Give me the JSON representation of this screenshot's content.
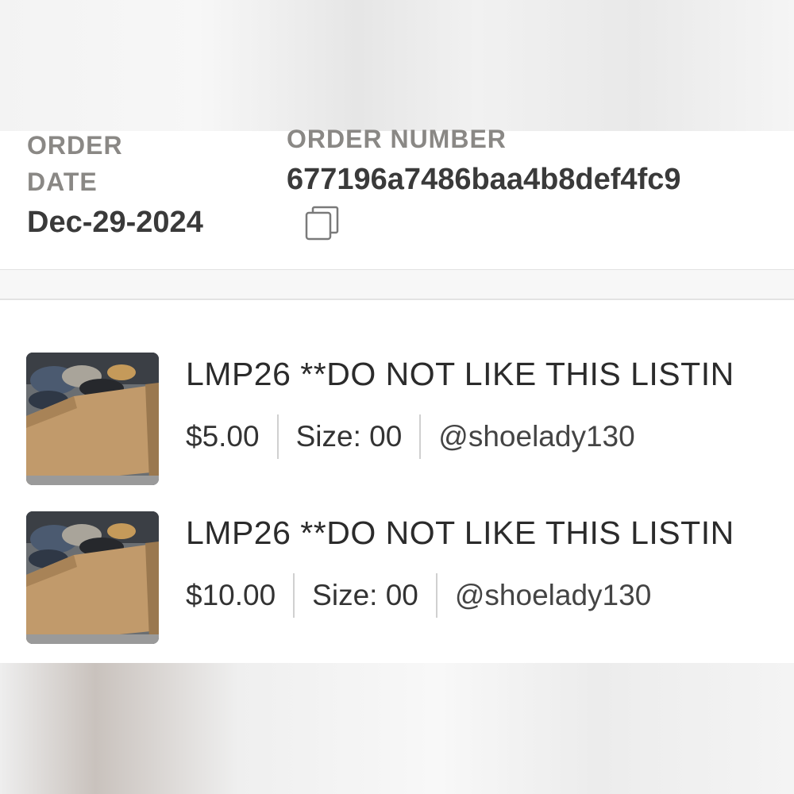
{
  "order": {
    "date_label_line1": "ORDER",
    "date_label_line2": "DATE",
    "date_value": "Dec-29-2024",
    "number_label": "ORDER NUMBER",
    "number_value": "677196a7486baa4b8def4fc9",
    "copy_icon": "copy-icon"
  },
  "items": [
    {
      "title": "LMP26 **DO NOT LIKE THIS LISTIN",
      "price": "$5.00",
      "size": "Size: 00",
      "seller": "@shoelady130",
      "image": "cardboard box of clothes"
    },
    {
      "title": "LMP26 **DO NOT LIKE THIS LISTIN",
      "price": "$10.00",
      "size": "Size: 00",
      "seller": "@shoelady130",
      "image": "cardboard box of clothes"
    }
  ],
  "colors": {
    "label": "#8a8885",
    "text": "#3a3a3a",
    "divider": "#e3e3e3"
  }
}
